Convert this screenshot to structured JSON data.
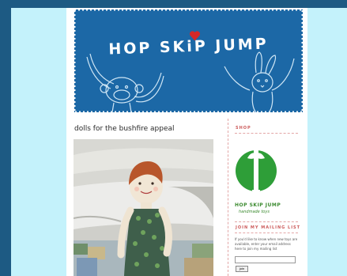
{
  "blog": {
    "title": "HOP SKiP JUMP"
  },
  "post": {
    "title": "dolls for the bushfire appeal"
  },
  "sidebar": {
    "shop_heading": "SHOP",
    "shop_name": "HOP SKIP JUMP",
    "shop_subtitle": "handmade toys",
    "mailing_heading": "JOIN MY MAILING LIST",
    "mailing_text": "If you'd like to know when new toys are available, enter your email address here to join my mailing list",
    "email_placeholder": "",
    "join_button": "join"
  },
  "colors": {
    "background": "#1d5a83",
    "frame": "#c4f2fb",
    "banner": "#1c68a6",
    "heart": "#d62828",
    "logo_green": "#2e9e38",
    "accent_pink": "#cc5b5b"
  }
}
